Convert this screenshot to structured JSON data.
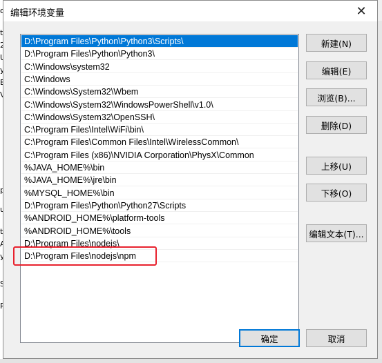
{
  "background_window": {
    "left_glyphs": [
      "o",
      "t",
      "2",
      "U",
      "y",
      "E",
      "V",
      "p",
      "u",
      "t",
      "A",
      "y",
      "S",
      "R"
    ],
    "left_glyphs_top": [
      10,
      42,
      60,
      78,
      96,
      114,
      132,
      270,
      298,
      330,
      348,
      366,
      406,
      438
    ]
  },
  "dialog": {
    "title": "编辑环境变量",
    "close_glyph": "✕"
  },
  "list": {
    "selected_index": 0,
    "items": [
      "D:\\Program Files\\Python\\Python3\\Scripts\\",
      "D:\\Program Files\\Python\\Python3\\",
      "C:\\Windows\\system32",
      "C:\\Windows",
      "C:\\Windows\\System32\\Wbem",
      "C:\\Windows\\System32\\WindowsPowerShell\\v1.0\\",
      "C:\\Windows\\System32\\OpenSSH\\",
      "C:\\Program Files\\Intel\\WiFi\\bin\\",
      "C:\\Program Files\\Common Files\\Intel\\WirelessCommon\\",
      "C:\\Program Files (x86)\\NVIDIA Corporation\\PhysX\\Common",
      "%JAVA_HOME%\\bin",
      "%JAVA_HOME%\\jre\\bin",
      "%MYSQL_HOME%\\bin",
      "D:\\Program Files\\Python\\Python27\\Scripts",
      "%ANDROID_HOME%\\platform-tools",
      "%ANDROID_HOME%\\tools",
      "D:\\Program Files\\nodejs\\",
      "D:\\Program Files\\nodejs\\npm"
    ]
  },
  "buttons": {
    "new": "新建(N)",
    "edit": "编辑(E)",
    "browse": "浏览(B)...",
    "delete": "删除(D)",
    "move_up": "上移(U)",
    "move_down": "下移(O)",
    "edit_text": "编辑文本(T)...",
    "ok": "确定",
    "cancel": "取消"
  },
  "colors": {
    "selection": "#0078d7",
    "annotation_box": "#e8212d"
  }
}
